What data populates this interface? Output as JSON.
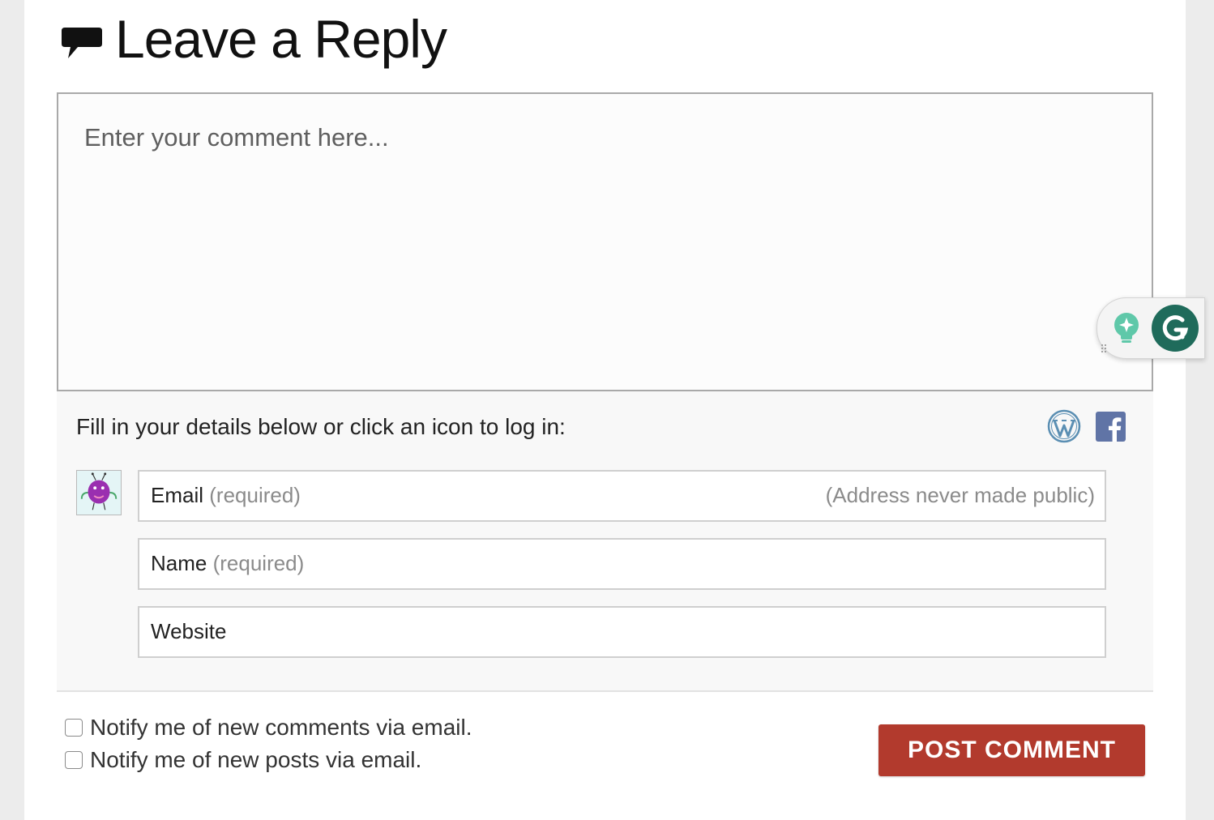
{
  "header": {
    "title": "Leave a Reply",
    "icon": "speech-bubble-icon"
  },
  "comment": {
    "placeholder": "Enter your comment here..."
  },
  "grammarly": {
    "icons": [
      "lightbulb-sparkle-icon",
      "grammarly-logo-icon"
    ]
  },
  "details": {
    "prompt": "Fill in your details below or click an icon to log in:",
    "login_icons": [
      "wordpress-icon",
      "facebook-icon"
    ],
    "avatar": "monster-avatar",
    "fields": {
      "email": {
        "label": "Email",
        "required": "(required)",
        "note": "(Address never made public)"
      },
      "name": {
        "label": "Name",
        "required": "(required)"
      },
      "website": {
        "label": "Website"
      }
    }
  },
  "notify": {
    "comments": "Notify me of new comments via email.",
    "posts": "Notify me of new posts via email."
  },
  "submit": {
    "label": "POST COMMENT",
    "color": "#b23a2d"
  }
}
